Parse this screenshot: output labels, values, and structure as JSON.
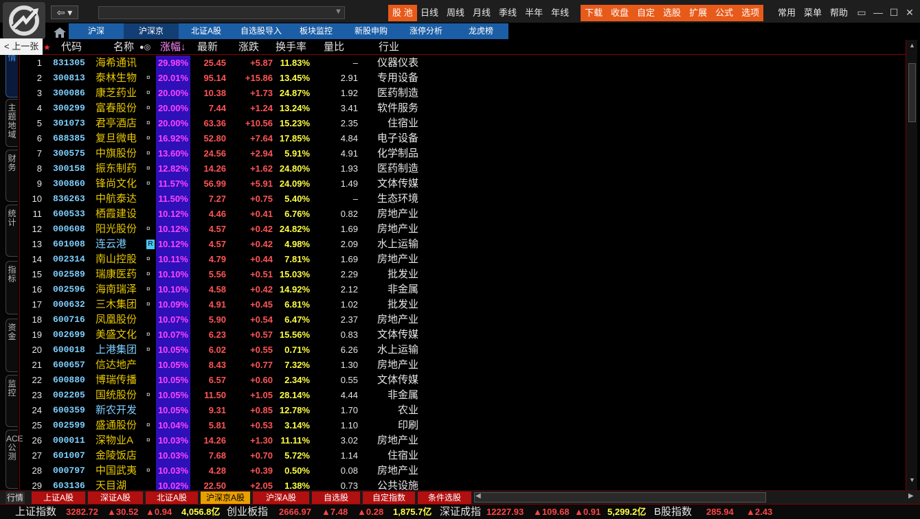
{
  "toolbar": {
    "prev_label": "上一张",
    "nav_arrow": "⇦ ▾",
    "address_value": "",
    "menu_hl_1": [
      "股 池"
    ],
    "menu_plain_1": [
      "日线",
      "周线",
      "月线",
      "季线",
      "半年",
      "年线"
    ],
    "menu_hl_2": [
      "下载",
      "收盘",
      "自定",
      "选股",
      "扩展",
      "公式",
      "选项"
    ],
    "menu_plain_2": [
      "常用",
      "菜单",
      "帮助"
    ],
    "window_buttons": [
      "▭",
      "—",
      "☐",
      "✕"
    ]
  },
  "tabs_bar": [
    "沪深",
    "沪深京",
    "北证A股",
    "自选股导入",
    "板块监控",
    "新股申购",
    "涨停分析",
    "龙虎榜"
  ],
  "side_tabs": [
    "行情",
    "主题地域",
    "财务",
    "统计",
    "指标",
    "资金",
    "监控",
    "ACE公测"
  ],
  "columns": {
    "star": "★",
    "code": "代码",
    "name": "名称",
    "dots": "●◎",
    "pct": "涨幅↓",
    "last": "最新",
    "chg": "涨跌",
    "turnover": "换手率",
    "vol_ratio": "量比",
    "industry": "行业"
  },
  "rows": [
    {
      "idx": "1",
      "code": "831305",
      "name": "海希通讯",
      "flag": "",
      "pct": "29.98%",
      "last": "25.45",
      "chg": "+5.87",
      "turn": "11.83%",
      "ratio": "–",
      "ind": "仪器仪表"
    },
    {
      "idx": "2",
      "code": "300813",
      "name": "泰林生物",
      "flag": "¤",
      "pct": "20.01%",
      "last": "95.14",
      "chg": "+15.86",
      "turn": "13.45%",
      "ratio": "2.91",
      "ind": "专用设备"
    },
    {
      "idx": "3",
      "code": "300086",
      "name": "康芝药业",
      "flag": "¤",
      "pct": "20.00%",
      "last": "10.38",
      "chg": "+1.73",
      "turn": "24.87%",
      "ratio": "1.92",
      "ind": "医药制造"
    },
    {
      "idx": "4",
      "code": "300299",
      "name": "富春股份",
      "flag": "¤",
      "pct": "20.00%",
      "last": "7.44",
      "chg": "+1.24",
      "turn": "13.24%",
      "ratio": "3.41",
      "ind": "软件服务"
    },
    {
      "idx": "5",
      "code": "301073",
      "name": "君亭酒店",
      "flag": "¤",
      "pct": "20.00%",
      "last": "63.36",
      "chg": "+10.56",
      "turn": "15.23%",
      "ratio": "2.35",
      "ind": "住宿业"
    },
    {
      "idx": "6",
      "code": "688385",
      "name": "复旦微电",
      "flag": "¤",
      "pct": "16.92%",
      "last": "52.80",
      "chg": "+7.64",
      "turn": "17.85%",
      "ratio": "4.84",
      "ind": "电子设备"
    },
    {
      "idx": "7",
      "code": "300575",
      "name": "中旗股份",
      "flag": "¤",
      "pct": "13.60%",
      "last": "24.56",
      "chg": "+2.94",
      "turn": "5.91%",
      "ratio": "4.91",
      "ind": "化学制品"
    },
    {
      "idx": "8",
      "code": "300158",
      "name": "振东制药",
      "flag": "¤",
      "pct": "12.82%",
      "last": "14.26",
      "chg": "+1.62",
      "turn": "24.80%",
      "ratio": "1.93",
      "ind": "医药制造"
    },
    {
      "idx": "9",
      "code": "300860",
      "name": "锋尚文化",
      "flag": "¤",
      "pct": "11.57%",
      "last": "56.99",
      "chg": "+5.91",
      "turn": "24.09%",
      "ratio": "1.49",
      "ind": "文体传媒"
    },
    {
      "idx": "10",
      "code": "836263",
      "name": "中航泰达",
      "flag": "",
      "pct": "11.50%",
      "last": "7.27",
      "chg": "+0.75",
      "turn": "5.40%",
      "ratio": "–",
      "ind": "生态环境"
    },
    {
      "idx": "11",
      "code": "600533",
      "name": "栖霞建设",
      "flag": "",
      "pct": "10.12%",
      "last": "4.46",
      "chg": "+0.41",
      "turn": "6.76%",
      "ratio": "0.82",
      "ind": "房地产业"
    },
    {
      "idx": "12",
      "code": "000608",
      "name": "阳光股份",
      "flag": "¤",
      "pct": "10.12%",
      "last": "4.57",
      "chg": "+0.42",
      "turn": "24.82%",
      "ratio": "1.69",
      "ind": "房地产业"
    },
    {
      "idx": "13",
      "code": "601008",
      "name": "连云港",
      "flag": "R",
      "pct": "10.12%",
      "last": "4.57",
      "chg": "+0.42",
      "turn": "4.98%",
      "ratio": "2.09",
      "ind": "水上运输"
    },
    {
      "idx": "14",
      "code": "002314",
      "name": "南山控股",
      "flag": "¤",
      "pct": "10.11%",
      "last": "4.79",
      "chg": "+0.44",
      "turn": "7.81%",
      "ratio": "1.69",
      "ind": "房地产业"
    },
    {
      "idx": "15",
      "code": "002589",
      "name": "瑞康医药",
      "flag": "¤",
      "pct": "10.10%",
      "last": "5.56",
      "chg": "+0.51",
      "turn": "15.03%",
      "ratio": "2.29",
      "ind": "批发业"
    },
    {
      "idx": "16",
      "code": "002596",
      "name": "海南瑞泽",
      "flag": "¤",
      "pct": "10.10%",
      "last": "4.58",
      "chg": "+0.42",
      "turn": "14.92%",
      "ratio": "2.12",
      "ind": "非金属"
    },
    {
      "idx": "17",
      "code": "000632",
      "name": "三木集团",
      "flag": "¤",
      "pct": "10.09%",
      "last": "4.91",
      "chg": "+0.45",
      "turn": "6.81%",
      "ratio": "1.02",
      "ind": "批发业"
    },
    {
      "idx": "18",
      "code": "600716",
      "name": "凤凰股份",
      "flag": "",
      "pct": "10.07%",
      "last": "5.90",
      "chg": "+0.54",
      "turn": "6.47%",
      "ratio": "2.37",
      "ind": "房地产业"
    },
    {
      "idx": "19",
      "code": "002699",
      "name": "美盛文化",
      "flag": "¤",
      "pct": "10.07%",
      "last": "6.23",
      "chg": "+0.57",
      "turn": "15.56%",
      "ratio": "0.83",
      "ind": "文体传媒"
    },
    {
      "idx": "20",
      "code": "600018",
      "name": "上港集团",
      "flag": "¤",
      "pct": "10.05%",
      "last": "6.02",
      "chg": "+0.55",
      "turn": "0.71%",
      "ratio": "6.26",
      "ind": "水上运输"
    },
    {
      "idx": "21",
      "code": "600657",
      "name": "信达地产",
      "flag": "",
      "pct": "10.05%",
      "last": "8.43",
      "chg": "+0.77",
      "turn": "7.32%",
      "ratio": "1.30",
      "ind": "房地产业"
    },
    {
      "idx": "22",
      "code": "600880",
      "name": "博瑞传播",
      "flag": "",
      "pct": "10.05%",
      "last": "6.57",
      "chg": "+0.60",
      "turn": "2.34%",
      "ratio": "0.55",
      "ind": "文体传媒"
    },
    {
      "idx": "23",
      "code": "002205",
      "name": "国统股份",
      "flag": "¤",
      "pct": "10.05%",
      "last": "11.50",
      "chg": "+1.05",
      "turn": "28.14%",
      "ratio": "4.44",
      "ind": "非金属"
    },
    {
      "idx": "24",
      "code": "600359",
      "name": "新农开发",
      "flag": "",
      "pct": "10.05%",
      "last": "9.31",
      "chg": "+0.85",
      "turn": "12.78%",
      "ratio": "1.70",
      "ind": "农业"
    },
    {
      "idx": "25",
      "code": "002599",
      "name": "盛通股份",
      "flag": "¤",
      "pct": "10.04%",
      "last": "5.81",
      "chg": "+0.53",
      "turn": "3.14%",
      "ratio": "1.10",
      "ind": "印刷"
    },
    {
      "idx": "26",
      "code": "000011",
      "name": "深物业A",
      "flag": "¤",
      "pct": "10.03%",
      "last": "14.26",
      "chg": "+1.30",
      "turn": "11.11%",
      "ratio": "3.02",
      "ind": "房地产业"
    },
    {
      "idx": "27",
      "code": "601007",
      "name": "金陵饭店",
      "flag": "",
      "pct": "10.03%",
      "last": "7.68",
      "chg": "+0.70",
      "turn": "5.72%",
      "ratio": "1.14",
      "ind": "住宿业"
    },
    {
      "idx": "28",
      "code": "000797",
      "name": "中国武夷",
      "flag": "¤",
      "pct": "10.03%",
      "last": "4.28",
      "chg": "+0.39",
      "turn": "0.50%",
      "ratio": "0.08",
      "ind": "房地产业"
    },
    {
      "idx": "29",
      "code": "603136",
      "name": "天目湖",
      "flag": "",
      "pct": "10.02%",
      "last": "22.50",
      "chg": "+2.05",
      "turn": "1.38%",
      "ratio": "0.73",
      "ind": "公共设施"
    }
  ],
  "bottom_tabs": {
    "lead": "行情",
    "items": [
      "上证A股",
      "深证A股",
      "北证A股",
      "沪深京A股",
      "沪深A股",
      "自选股",
      "自定指数",
      "条件选股"
    ]
  },
  "ticker": [
    {
      "name": "上证指数",
      "value": "3282.72",
      "chg": "▲30.52",
      "pct": "▲0.94",
      "amt": "4,056.8亿"
    },
    {
      "name": "创业板指",
      "value": "2666.97",
      "chg": "▲7.48",
      "pct": "▲0.28",
      "amt": "1,875.7亿"
    },
    {
      "name": "深证成指",
      "value": "12227.93",
      "chg": "▲109.68",
      "pct": "▲0.91",
      "amt": "5,299.2亿"
    },
    {
      "name": "B股指数",
      "value": "285.94",
      "chg": "▲2.43",
      "pct": "",
      "amt": ""
    }
  ],
  "colors": {
    "accent": "#e85a1a",
    "tab_blue": "#1b5ea6",
    "pct_column": "#2d10b8"
  }
}
